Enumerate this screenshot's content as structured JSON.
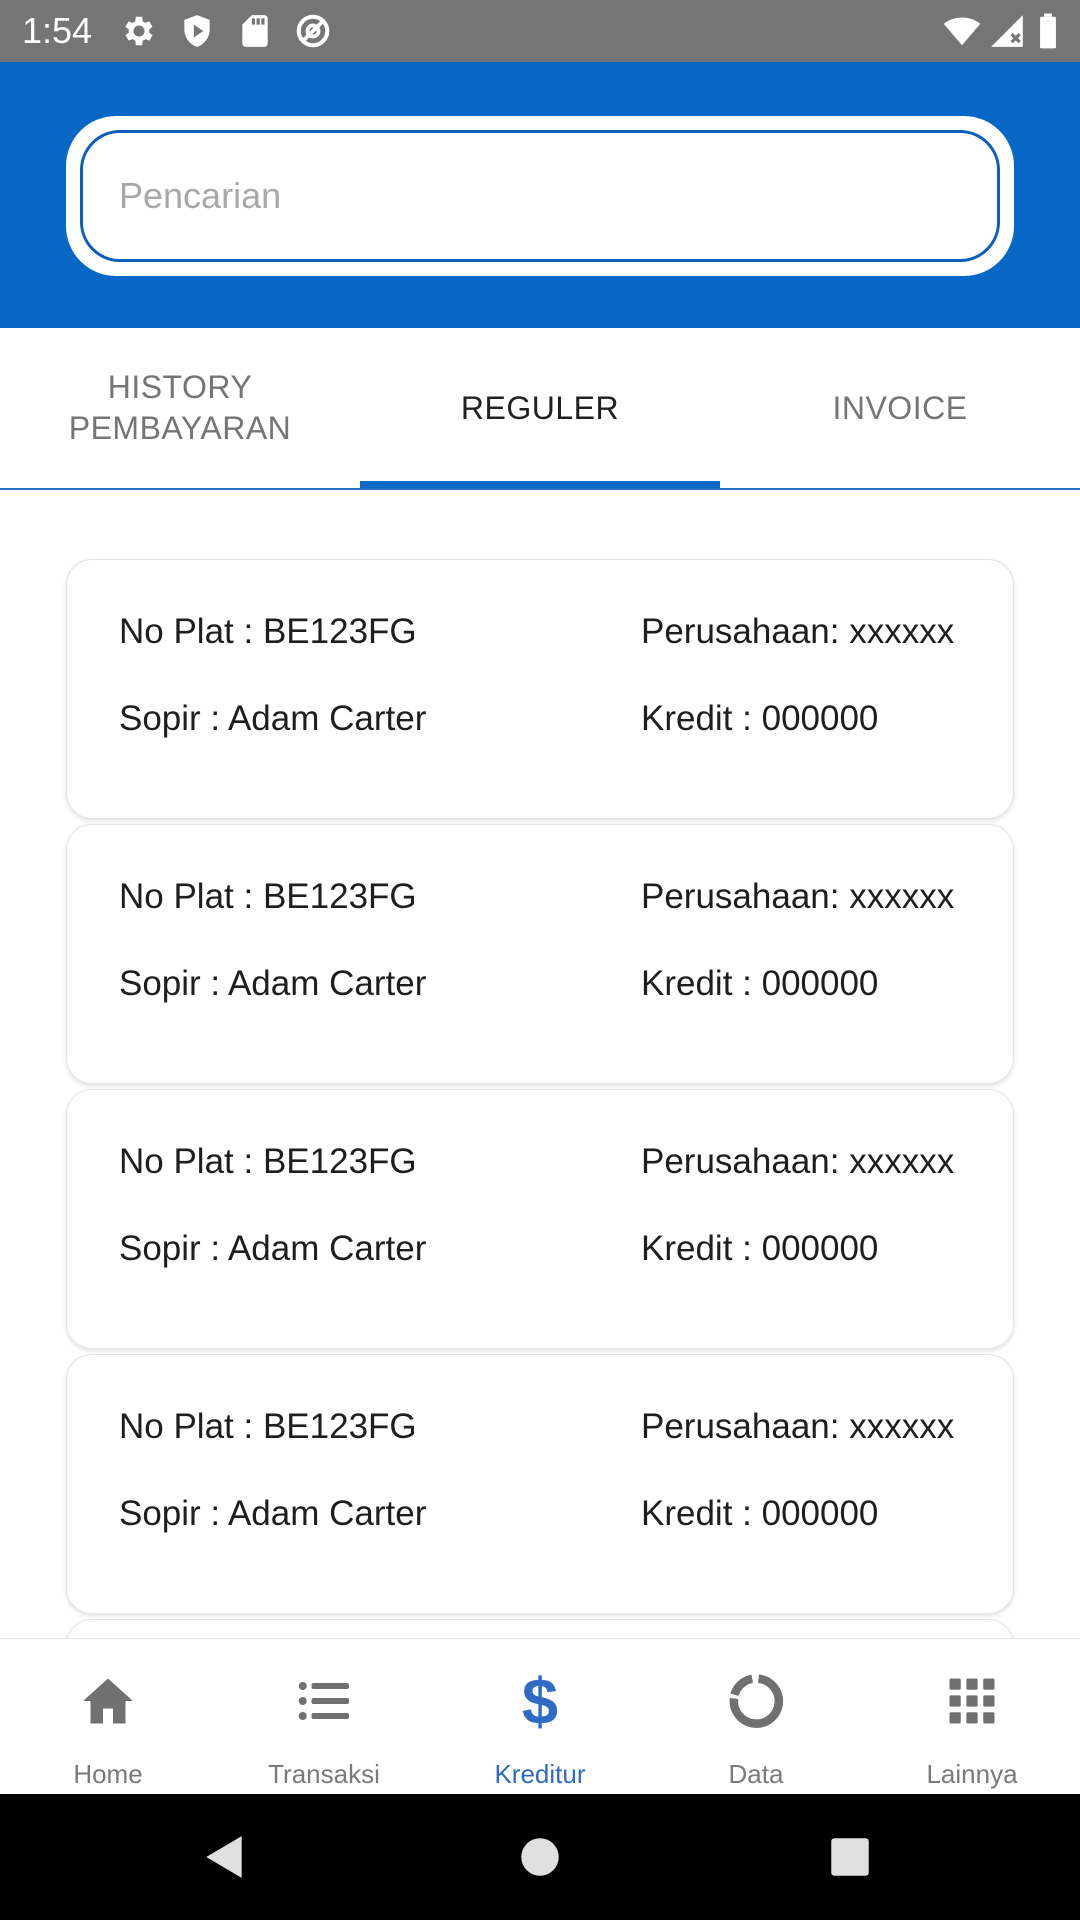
{
  "status_bar": {
    "time": "1:54",
    "icons": [
      "gear-icon",
      "shield-play-icon",
      "sd-card-icon",
      "at-sign-icon",
      "wifi-icon",
      "signal-icon",
      "battery-icon"
    ]
  },
  "search": {
    "placeholder": "Pencarian",
    "value": ""
  },
  "tabs": [
    {
      "label_line1": "HISTORY",
      "label_line2": "PEMBAYARAN",
      "active": false
    },
    {
      "label": "REGULER",
      "active": true
    },
    {
      "label": "INVOICE",
      "active": false
    }
  ],
  "cards": [
    {
      "plat": "No Plat : BE123FG",
      "perusahaan": "Perusahaan: xxxxxx",
      "sopir": "Sopir : Adam Carter",
      "kredit": "Kredit : 000000"
    },
    {
      "plat": "No Plat : BE123FG",
      "perusahaan": "Perusahaan: xxxxxx",
      "sopir": "Sopir : Adam Carter",
      "kredit": "Kredit : 000000"
    },
    {
      "plat": "No Plat : BE123FG",
      "perusahaan": "Perusahaan: xxxxxx",
      "sopir": "Sopir : Adam Carter",
      "kredit": "Kredit : 000000"
    },
    {
      "plat": "No Plat : BE123FG",
      "perusahaan": "Perusahaan: xxxxxx",
      "sopir": "Sopir : Adam Carter",
      "kredit": "Kredit : 000000"
    }
  ],
  "bottom_nav": [
    {
      "label": "Home",
      "icon": "home-icon",
      "active": false
    },
    {
      "label": "Transaksi",
      "icon": "list-icon",
      "active": false
    },
    {
      "label": "Kreditur",
      "icon": "dollar-icon",
      "active": true
    },
    {
      "label": "Data",
      "icon": "donut-chart-icon",
      "active": false
    },
    {
      "label": "Lainnya",
      "icon": "grid-icon",
      "active": false
    }
  ],
  "colors": {
    "brand_blue": "#0767c6",
    "active_nav": "#2f6bc4",
    "inactive": "#757575",
    "status_bar": "#757575"
  }
}
